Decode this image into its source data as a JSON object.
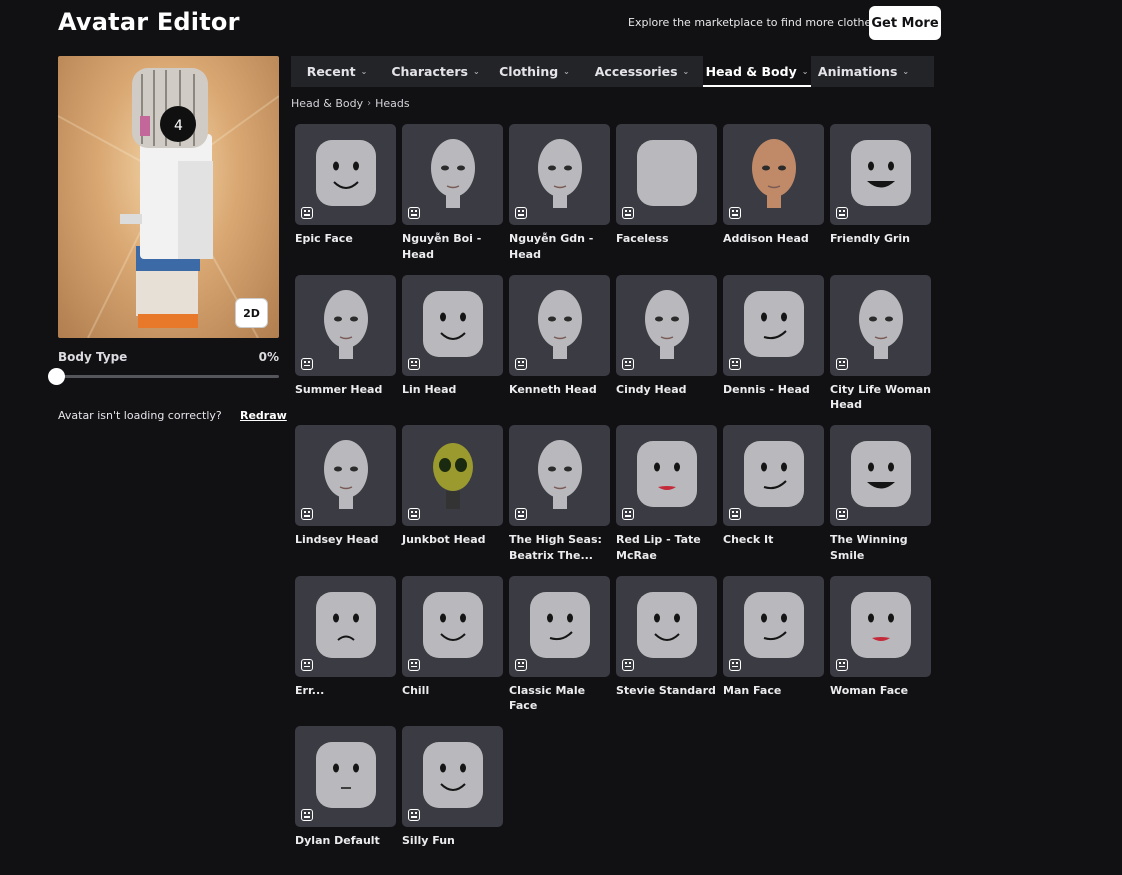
{
  "header": {
    "title": "Avatar Editor",
    "promo_text": "Explore the marketplace to find more clothes!",
    "get_more_label": "Get More"
  },
  "preview": {
    "toggle_label": "2D",
    "body_type_label": "Body Type",
    "body_type_value": "0%",
    "body_type_fraction": 0,
    "loading_text": "Avatar isn't loading correctly?",
    "redraw_label": "Redraw"
  },
  "tabs": [
    {
      "label": "Recent",
      "icon": "chevron-down-icon"
    },
    {
      "label": "Characters",
      "icon": "chevron-down-icon"
    },
    {
      "label": "Clothing",
      "icon": "chevron-down-icon"
    },
    {
      "label": "Accessories",
      "icon": "chevron-down-icon"
    },
    {
      "label": "Head & Body",
      "icon": "chevron-down-icon",
      "active": true
    },
    {
      "label": "Animations",
      "icon": "chevron-down-icon"
    }
  ],
  "breadcrumb": {
    "parent": "Head & Body",
    "separator_icon": "chevron-right-icon",
    "current": "Heads"
  },
  "items": [
    {
      "name": "Epic Face",
      "style": "smile"
    },
    {
      "name": "Nguyễn Boi - Head",
      "style": "realistic"
    },
    {
      "name": "Nguyễn Gdn - Head",
      "style": "realistic"
    },
    {
      "name": "Faceless",
      "style": "blank"
    },
    {
      "name": "Addison Head",
      "style": "skin"
    },
    {
      "name": "Friendly Grin",
      "style": "grin"
    },
    {
      "name": "Summer Head",
      "style": "realistic"
    },
    {
      "name": "Lin Head",
      "style": "smile"
    },
    {
      "name": "Kenneth Head",
      "style": "realistic"
    },
    {
      "name": "Cindy Head",
      "style": "realistic"
    },
    {
      "name": "Dennis - Head",
      "style": "smirk"
    },
    {
      "name": "City Life Woman Head",
      "style": "realistic"
    },
    {
      "name": "Lindsey Head",
      "style": "realistic"
    },
    {
      "name": "Junkbot Head",
      "style": "robot"
    },
    {
      "name": "The High Seas: Beatrix The...",
      "style": "realistic"
    },
    {
      "name": "Red Lip - Tate McRae",
      "style": "lips"
    },
    {
      "name": "Check It",
      "style": "smirk"
    },
    {
      "name": "The Winning Smile",
      "style": "grin"
    },
    {
      "name": "Err...",
      "style": "frown"
    },
    {
      "name": "Chill",
      "style": "smile"
    },
    {
      "name": "Classic Male Face",
      "style": "smirk"
    },
    {
      "name": "Stevie Standard",
      "style": "smile"
    },
    {
      "name": "Man Face",
      "style": "smirk"
    },
    {
      "name": "Woman Face",
      "style": "lips"
    },
    {
      "name": "Dylan Default",
      "style": "blank-eyes"
    },
    {
      "name": "Silly Fun",
      "style": "smile"
    }
  ],
  "colors": {
    "background": "#111114",
    "tab_bar": "#232428",
    "thumb_bg": "#3a3b43",
    "head_gray": "#b9b9bd",
    "skin": "#c08a68",
    "robot": "#9a9a2e"
  }
}
